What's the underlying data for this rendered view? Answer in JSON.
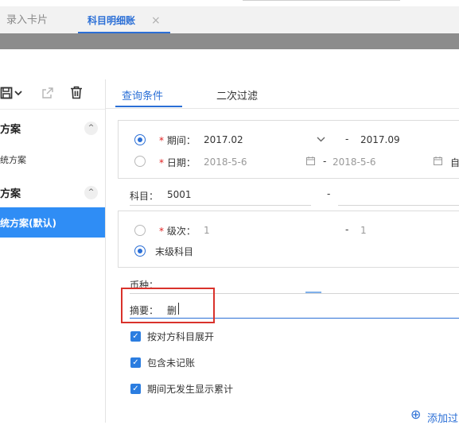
{
  "tabs": [
    {
      "label": "录入卡片",
      "active": false
    },
    {
      "label": "科目明细账",
      "active": true,
      "close": "×"
    }
  ],
  "left": {
    "group1": {
      "title": "方案",
      "item": "统方案"
    },
    "group2": {
      "title": "方案",
      "item": "统方案(默认)"
    },
    "chevron": "^"
  },
  "right_tabs": [
    {
      "label": "查询条件",
      "active": true
    },
    {
      "label": "二次过滤",
      "active": false
    }
  ],
  "period": {
    "label": "期间：",
    "star": "*",
    "from": "2017.02",
    "dash": "-",
    "to": "2017.09",
    "selected": true
  },
  "date": {
    "label": "日期：",
    "star": "*",
    "from": "2018-5-6",
    "dash": "-",
    "to": "2018-5-6",
    "trailing": "自"
  },
  "subject": {
    "label": "科目：",
    "from": "5001",
    "dash": "-"
  },
  "level": {
    "label": "级次：",
    "star": "*",
    "from": "1",
    "dash": "-",
    "to": "1"
  },
  "leaf": {
    "label": "末级科目",
    "selected": true
  },
  "currency": {
    "label": "币种："
  },
  "summary": {
    "label": "摘要：",
    "value": "删"
  },
  "checks": [
    {
      "label": "按对方科目展开",
      "checked": true
    },
    {
      "label": "包含未记账",
      "checked": true
    },
    {
      "label": "期间无发生显示累计",
      "checked": true
    }
  ],
  "add_filter": {
    "icon": "⊕",
    "label": "添加过"
  },
  "colors": {
    "accent": "#2b6fd6",
    "selected_bg": "#2f8df5",
    "highlight": "#d9322b",
    "required": "#e02020"
  }
}
